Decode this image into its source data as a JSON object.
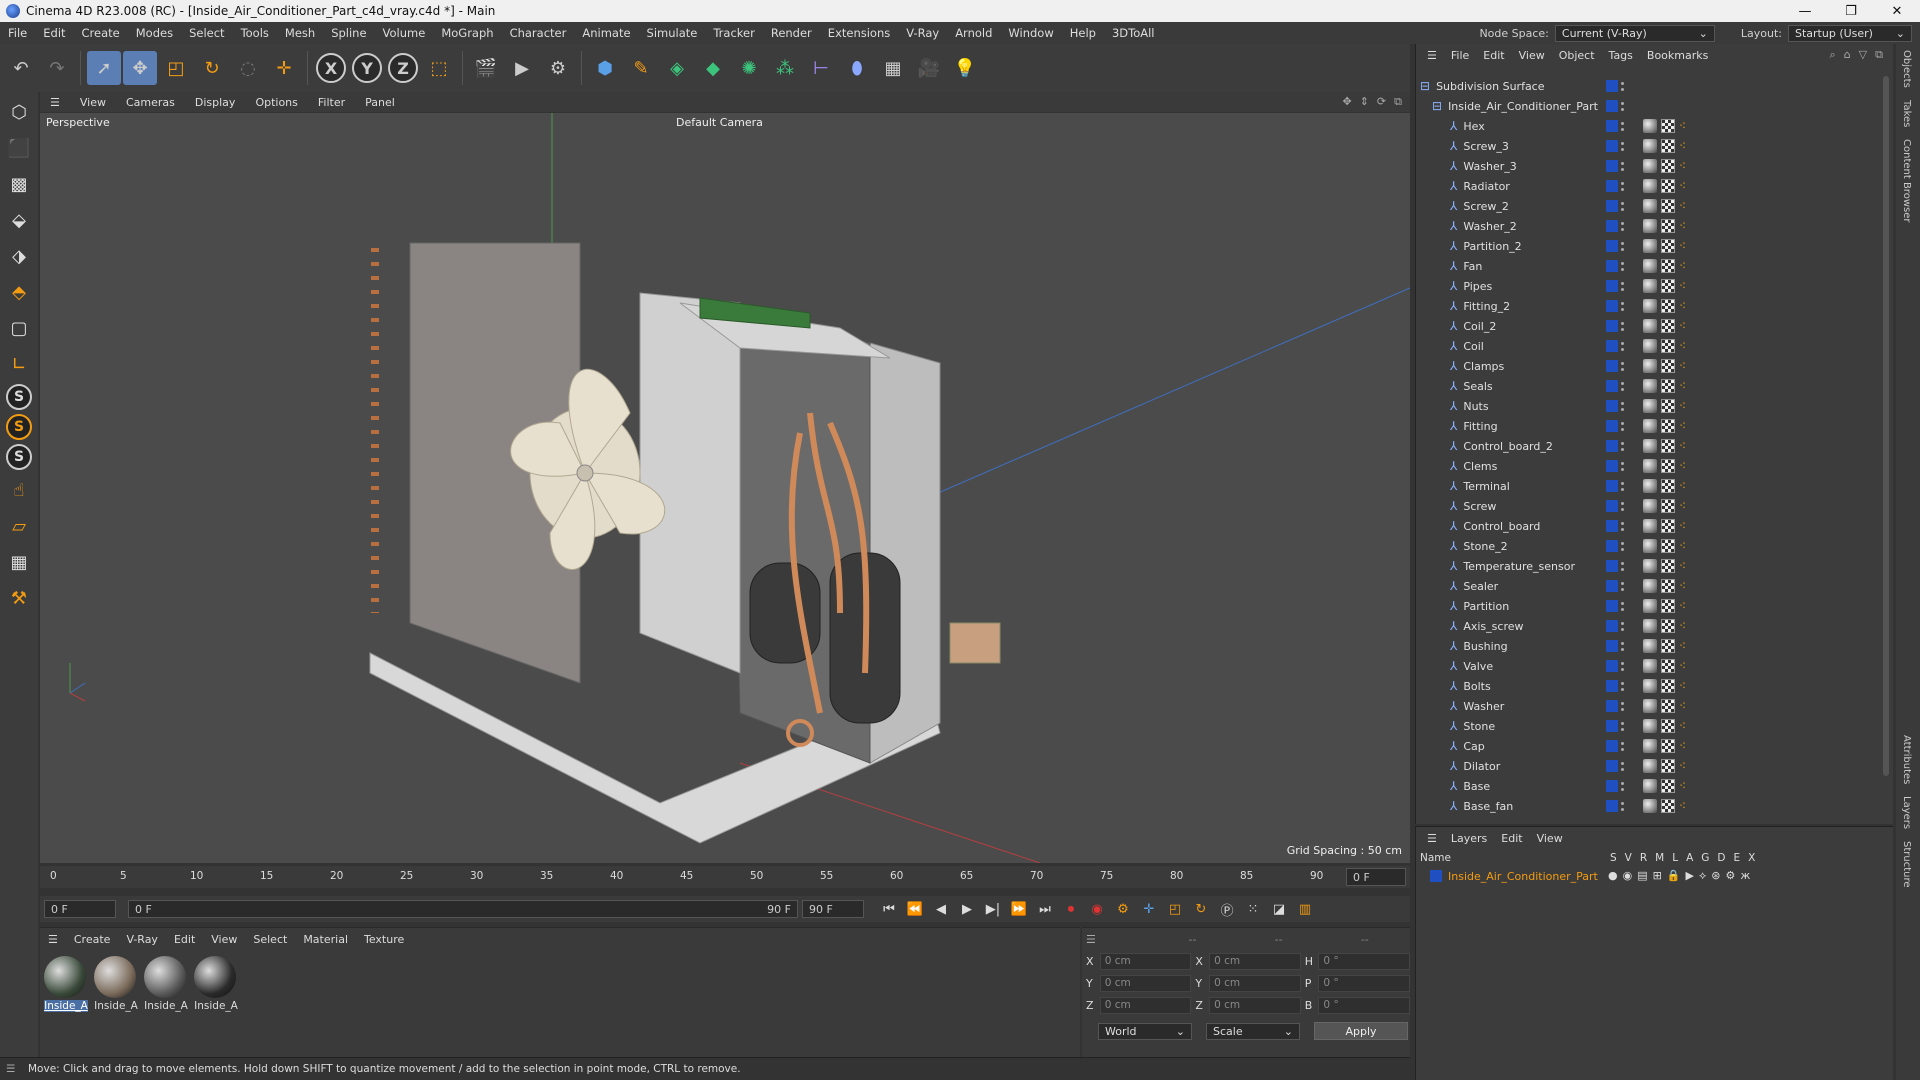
{
  "window": {
    "title": "Cinema 4D R23.008 (RC) - [Inside_Air_Conditioner_Part_c4d_vray.c4d *] - Main",
    "minimize": "—",
    "maximize": "❐",
    "close": "✕"
  },
  "menubar": {
    "items": [
      "File",
      "Edit",
      "Create",
      "Modes",
      "Select",
      "Tools",
      "Mesh",
      "Spline",
      "Volume",
      "MoGraph",
      "Character",
      "Animate",
      "Simulate",
      "Tracker",
      "Render",
      "Extensions",
      "V-Ray",
      "Arnold",
      "Window",
      "Help",
      "3DToAll"
    ],
    "node_space_label": "Node Space:",
    "node_space_value": "Current (V-Ray)",
    "layout_label": "Layout:",
    "layout_value": "Startup (User)"
  },
  "viewport": {
    "menu": [
      "View",
      "Cameras",
      "Display",
      "Options",
      "Filter",
      "Panel"
    ],
    "name": "Perspective",
    "camera": "Default Camera",
    "grid_spacing": "Grid Spacing : 50 cm"
  },
  "timeline": {
    "ticks": [
      "0",
      "5",
      "10",
      "15",
      "20",
      "25",
      "30",
      "35",
      "40",
      "45",
      "50",
      "55",
      "60",
      "65",
      "70",
      "75",
      "80",
      "85",
      "90"
    ],
    "end_field": "0 F"
  },
  "playback": {
    "start": "0 F",
    "range_start": "0 F",
    "range_end": "90 F",
    "max": "90 F"
  },
  "materials": {
    "menu": [
      "Create",
      "V-Ray",
      "Edit",
      "View",
      "Select",
      "Material",
      "Texture"
    ],
    "items": [
      {
        "label": "Inside_A",
        "selected": true,
        "color": "#3a4a3a"
      },
      {
        "label": "Inside_A",
        "selected": false,
        "color": "#7a6a5a"
      },
      {
        "label": "Inside_A",
        "selected": false,
        "color": "#5a5a5a"
      },
      {
        "label": "Inside_A",
        "selected": false,
        "color": "#2a2a2a"
      }
    ]
  },
  "coords": {
    "headers": [
      "--",
      "--",
      "--"
    ],
    "rows": [
      {
        "a1": "X",
        "v1": "0 cm",
        "a2": "X",
        "v2": "0 cm",
        "a3": "H",
        "v3": "0 °"
      },
      {
        "a1": "Y",
        "v1": "0 cm",
        "a2": "Y",
        "v2": "0 cm",
        "a3": "P",
        "v3": "0 °"
      },
      {
        "a1": "Z",
        "v1": "0 cm",
        "a2": "Z",
        "v2": "0 cm",
        "a3": "B",
        "v3": "0 °"
      }
    ],
    "world": "World",
    "scale": "Scale",
    "apply": "Apply"
  },
  "status": "Move: Click and drag to move elements. Hold down SHIFT to quantize movement / add to the selection in point mode, CTRL to remove.",
  "objects": {
    "menu": [
      "File",
      "Edit",
      "View",
      "Object",
      "Tags",
      "Bookmarks"
    ],
    "root": "Subdivision Surface",
    "parent": "Inside_Air_Conditioner_Part",
    "children": [
      "Hex",
      "Screw_3",
      "Washer_3",
      "Radiator",
      "Screw_2",
      "Washer_2",
      "Partition_2",
      "Fan",
      "Pipes",
      "Fitting_2",
      "Coil_2",
      "Coil",
      "Clamps",
      "Seals",
      "Nuts",
      "Fitting",
      "Control_board_2",
      "Clems",
      "Terminal",
      "Screw",
      "Control_board",
      "Stone_2",
      "Temperature_sensor",
      "Sealer",
      "Partition",
      "Axis_screw",
      "Bushing",
      "Valve",
      "Bolts",
      "Washer",
      "Stone",
      "Cap",
      "Dilator",
      "Base",
      "Base_fan"
    ]
  },
  "layers": {
    "menu": [
      "Layers",
      "Edit",
      "View"
    ],
    "name_header": "Name",
    "flag_headers": [
      "S",
      "V",
      "R",
      "M",
      "L",
      "A",
      "G",
      "D",
      "E",
      "X"
    ],
    "row": "Inside_Air_Conditioner_Part"
  },
  "right_tabs": [
    "Objects",
    "Takes",
    "Content Browser",
    "Attributes",
    "Layers",
    "Structure"
  ]
}
